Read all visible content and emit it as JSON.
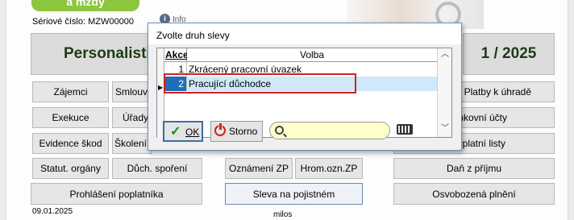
{
  "header": {
    "logo_text": "a mzdy",
    "serial_label": "Sériové číslo: MZW00000",
    "info_label": "Info"
  },
  "main": {
    "personalistika": "Personalistika",
    "period": "1 / 2025",
    "buttons": {
      "zajemci": "Zájemci",
      "smlouvy": "Smlouvy",
      "k_uhrade": "Platby k úhradě",
      "exekuce": "Exekuce",
      "urady": "Úřady",
      "ucty": "Bankovní účty",
      "evidence_skod": "Evidence škod",
      "s_item": "Školení",
      "listy": "Výplatní listy",
      "statut_organy": "Statut. orgány",
      "duch_sporeni": "Důch. spoření",
      "oznameni_zp": "Oznámení ZP",
      "hrom_ozn_zp": "Hrom.ozn.ZP",
      "dan_z_prijmu": "Daň z příjmu",
      "prohlaseni": "Prohlášení poplatníka",
      "sleva": "Sleva na pojistném",
      "osvobozena": "Osvobozená plnění"
    }
  },
  "footer": {
    "date": "09.01.2025",
    "user": "milos"
  },
  "dialog": {
    "title": "Zvolte druh slevy",
    "col_akce": "Akce",
    "col_volba": "Volba",
    "rows": [
      {
        "num": "1",
        "text": "Zkrácený pracovní úvazek"
      },
      {
        "num": "2",
        "text": "Pracující důchodce"
      }
    ],
    "ok": "OK",
    "storno": "Storno",
    "search_value": ""
  },
  "colors": {
    "selection": "#1e6fb8",
    "highlight_box": "#d02020",
    "logo": "#8cc63f"
  }
}
